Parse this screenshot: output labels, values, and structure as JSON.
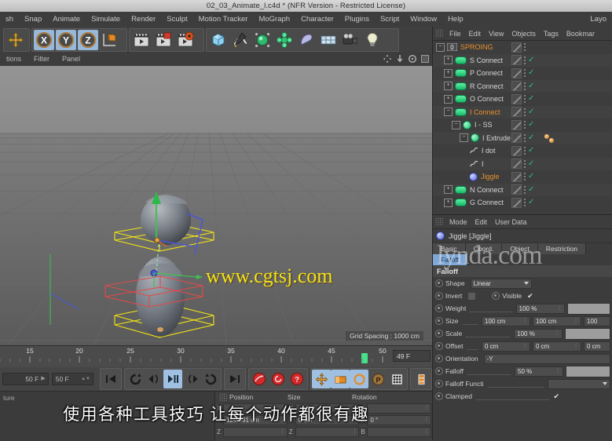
{
  "window": {
    "title": "02_03_Animate_l.c4d * (NFR Version - Restricted License)"
  },
  "menubar": {
    "items": [
      "sh",
      "Snap",
      "Animate",
      "Simulate",
      "Render",
      "Sculpt",
      "Motion Tracker",
      "MoGraph",
      "Character",
      "Plugins",
      "Script",
      "Window",
      "Help"
    ],
    "right_item": "Layo"
  },
  "toolbar": {
    "groups": [
      {
        "name": "move-group",
        "buttons": [
          {
            "icon": "move-axis-icon",
            "selected": false
          }
        ]
      },
      {
        "name": "axis-lock-group",
        "buttons": [
          {
            "icon": "x-axis-icon",
            "label": "X",
            "selected": true
          },
          {
            "icon": "y-axis-icon",
            "label": "Y",
            "selected": true
          },
          {
            "icon": "z-axis-icon",
            "label": "Z",
            "selected": true
          },
          {
            "icon": "world-object-coordinate-icon",
            "selected": false
          }
        ]
      },
      {
        "name": "render-group",
        "buttons": [
          {
            "icon": "render-view-icon",
            "selected": false
          },
          {
            "icon": "render-region-icon",
            "selected": false
          },
          {
            "icon": "render-settings-icon",
            "selected": false
          }
        ]
      },
      {
        "name": "primitives-group",
        "buttons": [
          {
            "icon": "cube-primitive-icon",
            "selected": false
          },
          {
            "icon": "spline-pen-icon",
            "selected": false
          },
          {
            "icon": "nurbs-generator-icon",
            "selected": false
          },
          {
            "icon": "array-modeling-icon",
            "selected": false
          },
          {
            "icon": "deformer-bend-icon",
            "selected": false
          },
          {
            "icon": "environment-floor-icon",
            "selected": false
          },
          {
            "icon": "camera-icon",
            "selected": false
          },
          {
            "icon": "light-bulb-icon",
            "selected": false
          }
        ]
      }
    ]
  },
  "viewport_header": {
    "items": [
      "tions",
      "Filter",
      "Panel"
    ],
    "nav_icons": [
      "pan-icon",
      "dolly-icon",
      "rotate-icon",
      "maximize-viewport-icon"
    ]
  },
  "viewport": {
    "grid_spacing_label": "Grid Spacing : 1000 cm",
    "watermark": "www.cgtsj.com"
  },
  "timeline": {
    "tick_labels": [
      "15",
      "20",
      "25",
      "30",
      "35",
      "40",
      "45",
      "50"
    ],
    "current_frame_field": "49 F",
    "playhead_frame": 49
  },
  "transport": {
    "range_start_field": "50 F",
    "range_end_field": "50 F",
    "buttons": [
      {
        "name": "go-to-start-button",
        "icon": "skip-start-icon",
        "selected": false
      },
      {
        "name": "play-reverse-loop-button",
        "icon": "loop-ccw-icon",
        "selected": false
      },
      {
        "name": "previous-key-button",
        "icon": "prev-key-icon",
        "selected": false
      },
      {
        "name": "play-pause-button",
        "icon": "play-pause-icon",
        "selected": true
      },
      {
        "name": "next-key-button",
        "icon": "next-key-icon",
        "selected": false
      },
      {
        "name": "play-forward-loop-button",
        "icon": "loop-cw-icon",
        "selected": false
      },
      {
        "name": "go-to-end-button",
        "icon": "skip-end-icon",
        "selected": false
      },
      {
        "name": "record-active-objects-button",
        "icon": "record-icon",
        "selected": false
      },
      {
        "name": "autokeying-button",
        "icon": "autokey-icon",
        "selected": false
      },
      {
        "name": "keyframe-selection-button",
        "icon": "question-key-icon",
        "selected": false
      },
      {
        "name": "record-position-button",
        "icon": "position-key-icon",
        "selected": true
      },
      {
        "name": "record-scale-button",
        "icon": "scale-key-icon",
        "selected": true
      },
      {
        "name": "record-rotation-button",
        "icon": "rotation-key-icon",
        "selected": true
      },
      {
        "name": "record-pla-button",
        "icon": "pla-key-icon",
        "selected": false
      },
      {
        "name": "record-parameter-button",
        "icon": "parameter-key-icon",
        "selected": false
      },
      {
        "name": "keyframe-mode-button",
        "icon": "keyframe-mode-icon",
        "selected": false
      }
    ]
  },
  "material_manager": {
    "header": "ture"
  },
  "coordinate_manager": {
    "columns": [
      "Position",
      "Size",
      "Rotation"
    ],
    "rows": [
      {
        "axis_p": "X",
        "position": "",
        "axis_s": "X",
        "size": "",
        "axis_r": "H",
        "rotation": ""
      },
      {
        "axis_p": "Y",
        "position": "124.891 cm",
        "axis_s": "Y",
        "size": "0 cm",
        "axis_r": "P",
        "rotation": "0 °"
      },
      {
        "axis_p": "Z",
        "position": "",
        "axis_s": "Z",
        "size": "",
        "axis_r": "B",
        "rotation": ""
      }
    ]
  },
  "subtitle": {
    "text": "使用各种工具技巧 让每个动作都很有趣"
  },
  "object_manager": {
    "menu": [
      "File",
      "Edit",
      "View",
      "Objects",
      "Tags",
      "Bookmar"
    ],
    "rows": [
      {
        "name": "SPROING",
        "indent": 0,
        "icon": "layer-zero-icon",
        "highlighted": true,
        "expander": "minus",
        "check": false,
        "tag": false
      },
      {
        "name": "S Connect",
        "indent": 1,
        "icon": "connect-object-icon",
        "highlighted": false,
        "expander": "plus",
        "check": true,
        "tag": false
      },
      {
        "name": "P Connect",
        "indent": 1,
        "icon": "connect-object-icon",
        "highlighted": false,
        "expander": "plus",
        "check": true,
        "tag": false
      },
      {
        "name": "R Connect",
        "indent": 1,
        "icon": "connect-object-icon",
        "highlighted": false,
        "expander": "plus",
        "check": true,
        "tag": false
      },
      {
        "name": "O Connect",
        "indent": 1,
        "icon": "connect-object-icon",
        "highlighted": false,
        "expander": "plus",
        "check": true,
        "tag": false
      },
      {
        "name": "I Connect",
        "indent": 1,
        "icon": "connect-object-icon",
        "highlighted": true,
        "expander": "minus",
        "check": true,
        "tag": false
      },
      {
        "name": "I - SS",
        "indent": 2,
        "icon": "subdivision-surface-icon",
        "highlighted": false,
        "expander": "minus",
        "check": true,
        "tag": false
      },
      {
        "name": "I Extrude",
        "indent": 3,
        "icon": "extrude-nurbs-icon",
        "highlighted": false,
        "expander": "minus",
        "check": true,
        "tag": true
      },
      {
        "name": "I dot",
        "indent": 4,
        "icon": "spline-icon",
        "highlighted": false,
        "expander": "none",
        "check": true,
        "tag": false
      },
      {
        "name": "I",
        "indent": 4,
        "icon": "spline-icon",
        "highlighted": false,
        "expander": "none",
        "check": true,
        "tag": false
      },
      {
        "name": "Jiggle",
        "indent": 3,
        "icon": "jiggle-deformer-icon",
        "highlighted": true,
        "expander": "none",
        "check": true,
        "tag": false
      },
      {
        "name": "N Connect",
        "indent": 1,
        "icon": "connect-object-icon",
        "highlighted": false,
        "expander": "plus",
        "check": true,
        "tag": false
      },
      {
        "name": "G Connect",
        "indent": 1,
        "icon": "connect-object-icon",
        "highlighted": false,
        "expander": "plus",
        "check": true,
        "tag": false
      }
    ]
  },
  "attribute_manager": {
    "menu": [
      "Mode",
      "Edit",
      "User Data"
    ],
    "object_title": "Jiggle [Jiggle]",
    "tabs_row1": [
      "Basic",
      "Coord.",
      "Object",
      "Restriction"
    ],
    "tabs_row2": [
      {
        "label": "Falloff",
        "active": true
      }
    ],
    "section_header": "Falloff",
    "properties": [
      {
        "name": "shape",
        "label": "Shape",
        "type": "select",
        "value": "Linear",
        "dots": false
      },
      {
        "name": "invert",
        "label": "Invert",
        "type": "checkbox",
        "value": false,
        "dots": false,
        "second_label": "Visible",
        "second_value": true
      },
      {
        "name": "weight",
        "label": "Weight",
        "type": "field-slider",
        "value": "100 %",
        "dots": true
      },
      {
        "name": "size",
        "label": "Size",
        "type": "field3",
        "value": "100 cm",
        "value2": "100 cm",
        "value3": "100",
        "dots": true
      },
      {
        "name": "scale",
        "label": "Scale",
        "type": "field-slider",
        "value": "100 %",
        "dots": true
      },
      {
        "name": "offset",
        "label": "Offset",
        "type": "field3",
        "value": "0 cm",
        "value2": "0 cm",
        "value3": "0 cm",
        "dots": true
      },
      {
        "name": "orientation",
        "label": "Orientation",
        "type": "select-wide",
        "value": "-Y",
        "dots": false
      },
      {
        "name": "falloff",
        "label": "Falloff",
        "type": "field-slider",
        "value": "50 %",
        "dots": true
      },
      {
        "name": "falloff-function",
        "label": "Falloff Functi",
        "type": "select",
        "value": "",
        "dots": true
      },
      {
        "name": "clamped",
        "label": "Clamped",
        "type": "checkbox",
        "value": true,
        "dots": true
      }
    ],
    "watermark": "lynda.com"
  },
  "colors": {
    "accent_orange": "#e8912c",
    "accent_blue": "#7fa8d8",
    "green_check": "#2fbf7a",
    "subtitle_yellow": "#f2e316"
  }
}
